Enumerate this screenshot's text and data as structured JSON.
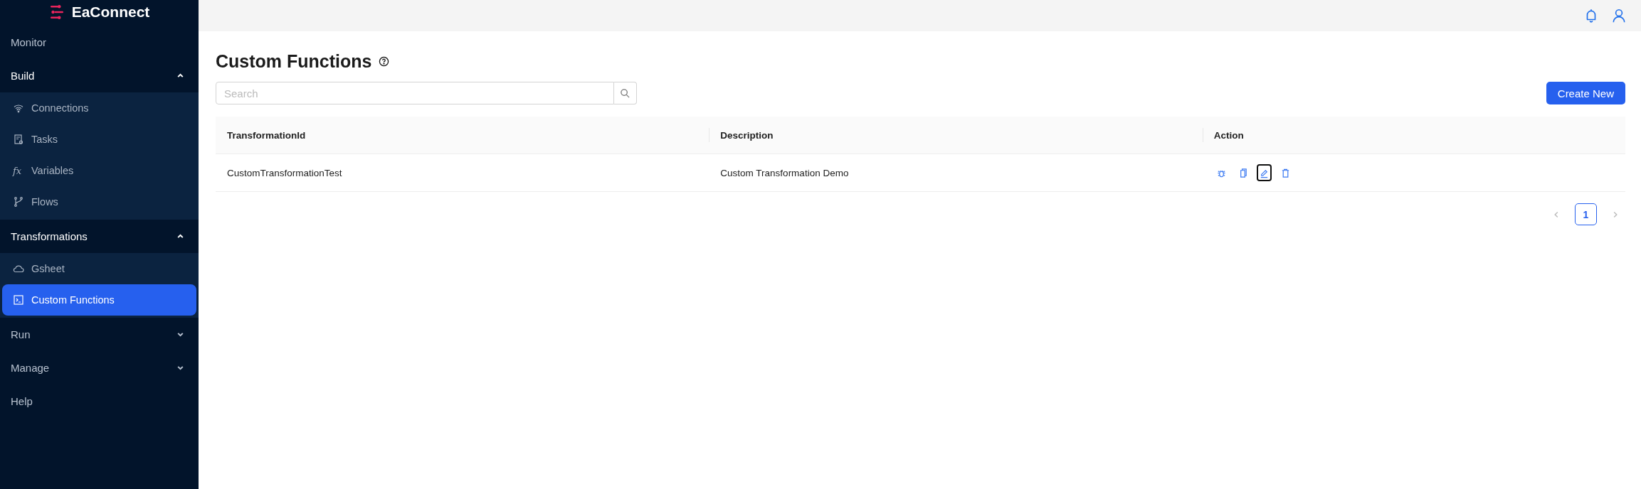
{
  "brand": {
    "name": "EaConnect"
  },
  "sidebar": {
    "items": [
      {
        "kind": "link",
        "label": "Monitor"
      },
      {
        "kind": "group",
        "label": "Build",
        "expanded": true,
        "children": [
          {
            "label": "Connections",
            "kind": "wifi",
            "selected": false
          },
          {
            "label": "Tasks",
            "kind": "task",
            "selected": false
          },
          {
            "label": "Variables",
            "kind": "fx",
            "glyph": "fx",
            "selected": false
          },
          {
            "label": "Flows",
            "kind": "branch",
            "selected": false
          }
        ]
      },
      {
        "kind": "group",
        "label": "Transformations",
        "expanded": true,
        "children": [
          {
            "label": "Gsheet",
            "kind": "cloud",
            "selected": false
          },
          {
            "label": "Custom Functions",
            "kind": "terminal",
            "selected": true
          }
        ]
      },
      {
        "kind": "group",
        "label": "Run",
        "expanded": false
      },
      {
        "kind": "group",
        "label": "Manage",
        "expanded": false
      },
      {
        "kind": "link",
        "label": "Help"
      }
    ]
  },
  "page": {
    "title": "Custom Functions"
  },
  "search": {
    "placeholder": "Search"
  },
  "create_button": "Create New",
  "table": {
    "columns": [
      "TransformationId",
      "Description",
      "Action"
    ],
    "rows": [
      {
        "cells": [
          "CustomTransformationTest",
          "Custom Transformation Demo"
        ],
        "actions": [
          {
            "kind": "debug",
            "focused": false
          },
          {
            "kind": "copy",
            "focused": false
          },
          {
            "kind": "edit",
            "focused": true
          },
          {
            "kind": "delete",
            "focused": false
          }
        ]
      }
    ]
  },
  "pagination": {
    "pages": [
      {
        "label": "1",
        "selected": true
      }
    ]
  }
}
